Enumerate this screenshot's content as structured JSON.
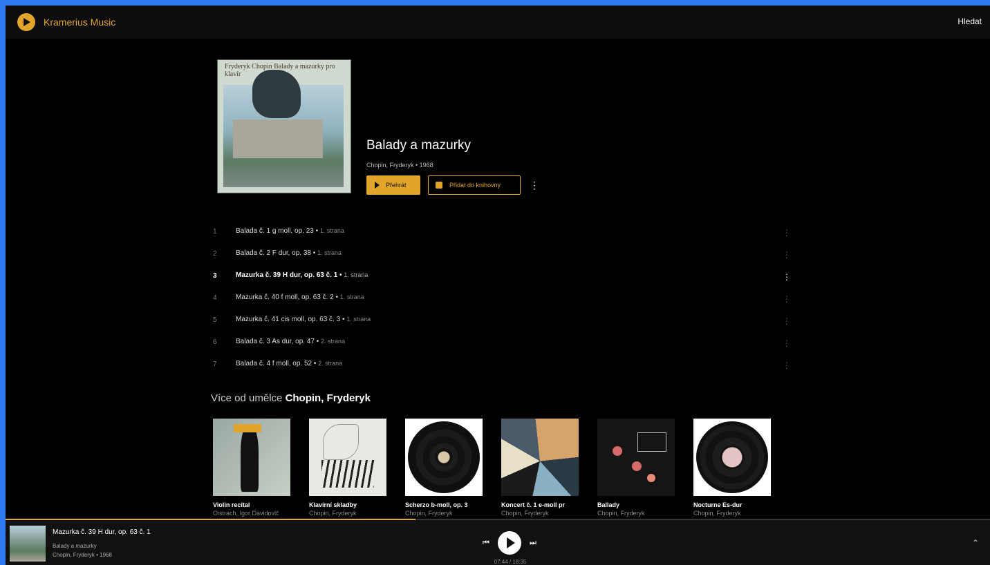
{
  "app": {
    "name": "Kramerius Music",
    "search_label": "Hledat"
  },
  "album": {
    "cover_text": "Fryderyk Chopin Balady a mazurky pro klavír",
    "title": "Balady a mazurky",
    "meta": "Chopin, Fryderyk  •  1968",
    "play_label": "Přehrát",
    "add_label": "Přidat do knihovny"
  },
  "tracks": [
    {
      "num": "1",
      "name": "Balada č. 1 g moll, op. 23",
      "side": "1. strana"
    },
    {
      "num": "2",
      "name": "Balada č. 2 F dur, op. 38",
      "side": "1. strana"
    },
    {
      "num": "3",
      "name": "Mazurka č. 39 H dur, op. 63 č. 1",
      "side": "1. strana"
    },
    {
      "num": "4",
      "name": "Mazurka č. 40 f moll, op. 63 č. 2",
      "side": "1. strana"
    },
    {
      "num": "5",
      "name": "Mazurka č. 41 cis moll, op. 63 č. 3",
      "side": "1. strana"
    },
    {
      "num": "6",
      "name": "Balada č. 3 As dur, op. 47",
      "side": "2. strana"
    },
    {
      "num": "7",
      "name": "Balada č. 4 f moll, op. 52",
      "side": "2. strana"
    }
  ],
  "more": {
    "prefix": "Více od umělce",
    "artist": "Chopin, Fryderyk",
    "cards": [
      {
        "title": "Violin recital",
        "artist": "Oistrach, Igor Davidovič"
      },
      {
        "title": "Klavírní skladby",
        "artist": "Chopin, Fryderyk"
      },
      {
        "title": "Scherzo b-moll, op. 3",
        "artist": "Chopin, Fryderyk"
      },
      {
        "title": "Koncert č. 1 e-moll pr",
        "artist": "Chopin, Fryderyk"
      },
      {
        "title": "Ballady",
        "artist": "Chopin, Fryderyk"
      },
      {
        "title": "Nocturne Es-dur",
        "artist": "Chopin, Fryderyk"
      }
    ]
  },
  "player": {
    "title": "Mazurka č. 39 H dur, op. 63 č. 1",
    "album": "Balady a mazurky",
    "meta": "Chopin, Fryderyk  •  1968",
    "time": "07:44 / 18:35",
    "progress_fraction": 0.4166
  },
  "colors": {
    "accent": "#e2a52b",
    "background": "#000000",
    "outer": "#2f7bf0"
  }
}
